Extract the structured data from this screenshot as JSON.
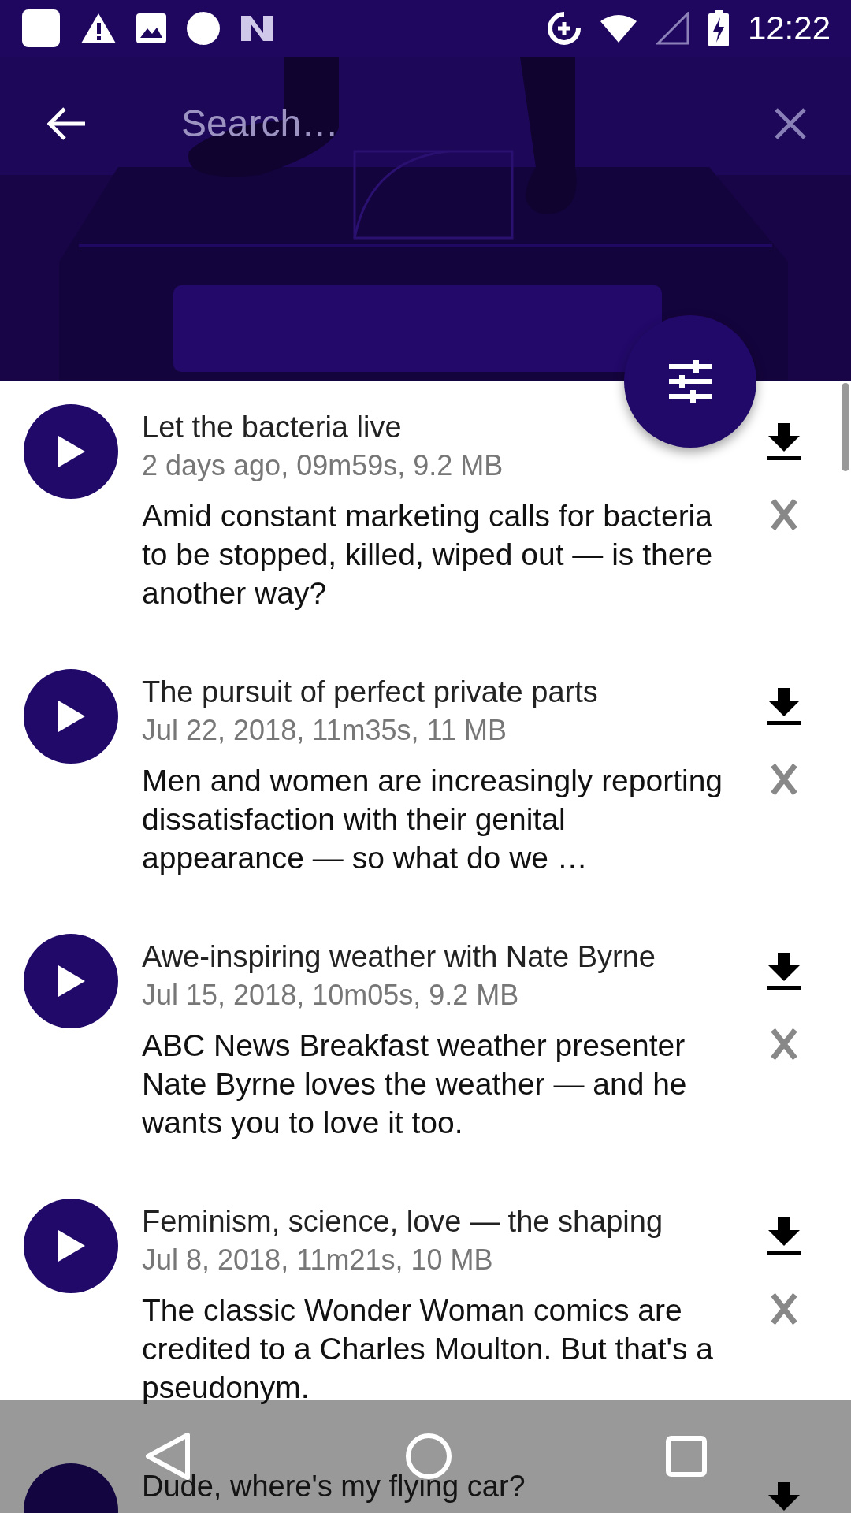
{
  "status_bar": {
    "time": "12:22"
  },
  "search": {
    "placeholder": "Search…"
  },
  "episodes": [
    {
      "title": "Let the bacteria live",
      "meta": "2 days ago, 09m59s, 9.2 MB",
      "description": "Amid constant marketing calls for bacteria to be stopped, killed, wiped out — is there another way?"
    },
    {
      "title": "The pursuit of perfect private parts",
      "meta": "Jul 22, 2018, 11m35s, 11 MB",
      "description": "Men and women are increasingly reporting dissatisfaction with their genital appearance — so what do we …"
    },
    {
      "title": "Awe-inspiring weather with Nate Byrne",
      "meta": "Jul 15, 2018, 10m05s, 9.2 MB",
      "description": "ABC News Breakfast weather presenter Nate Byrne loves the weather — and he wants you to love it too."
    },
    {
      "title": "Feminism, science, love — the shaping",
      "meta": "Jul 8, 2018, 11m21s, 10 MB",
      "description": "The classic Wonder Woman comics are credited to a Charles Moulton. But that's a pseudonym."
    },
    {
      "title": "Dude, where's my flying car?"
    }
  ]
}
